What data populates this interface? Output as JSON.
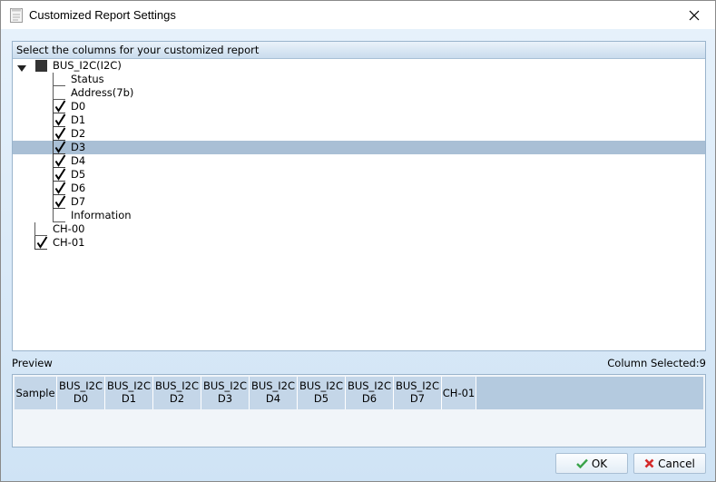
{
  "window": {
    "title": "Customized Report Settings"
  },
  "tree": {
    "header": "Select the columns for your customized report",
    "root": {
      "label": "BUS_I2C(I2C)",
      "state": "partial",
      "expanded": true
    },
    "children": [
      {
        "label": "Status",
        "checked": false
      },
      {
        "label": "Address(7b)",
        "checked": false
      },
      {
        "label": "D0",
        "checked": true
      },
      {
        "label": "D1",
        "checked": true
      },
      {
        "label": "D2",
        "checked": true
      },
      {
        "label": "D3",
        "checked": true,
        "selected": true
      },
      {
        "label": "D4",
        "checked": true
      },
      {
        "label": "D5",
        "checked": true
      },
      {
        "label": "D6",
        "checked": true
      },
      {
        "label": "D7",
        "checked": true
      },
      {
        "label": "Information",
        "checked": false
      }
    ],
    "channels": [
      {
        "label": "CH-00",
        "checked": false
      },
      {
        "label": "CH-01",
        "checked": true
      }
    ]
  },
  "preview": {
    "label": "Preview",
    "column_selected": "Column Selected:9",
    "columns": [
      {
        "line1": "Sample",
        "line2": ""
      },
      {
        "line1": "BUS_I2C",
        "line2": "D0"
      },
      {
        "line1": "BUS_I2C",
        "line2": "D1"
      },
      {
        "line1": "BUS_I2C",
        "line2": "D2"
      },
      {
        "line1": "BUS_I2C",
        "line2": "D3"
      },
      {
        "line1": "BUS_I2C",
        "line2": "D4"
      },
      {
        "line1": "BUS_I2C",
        "line2": "D5"
      },
      {
        "line1": "BUS_I2C",
        "line2": "D6"
      },
      {
        "line1": "BUS_I2C",
        "line2": "D7"
      },
      {
        "line1": "CH-01",
        "line2": ""
      }
    ]
  },
  "buttons": {
    "ok": "OK",
    "cancel": "Cancel"
  },
  "colors": {
    "selected_row": "#a9bfd5",
    "ok_icon": "#3aa34a",
    "cancel_icon": "#d42a2a"
  }
}
